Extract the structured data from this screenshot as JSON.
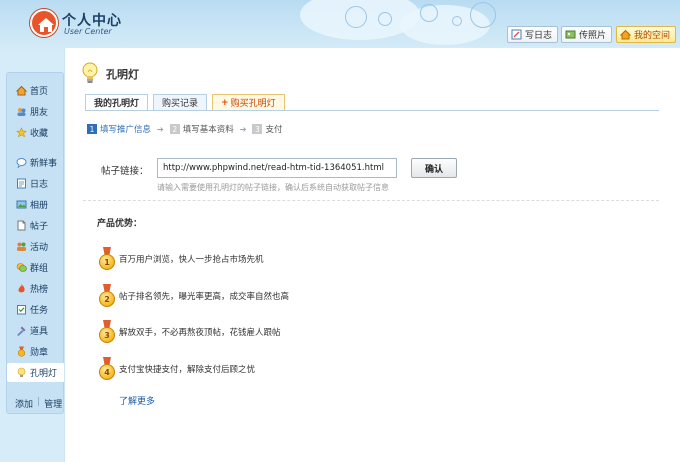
{
  "header": {
    "logo_title": "个人中心",
    "logo_subtitle": "User Center",
    "buttons": [
      {
        "label": "写日志",
        "icon": "edit-icon"
      },
      {
        "label": "传照片",
        "icon": "photo-icon"
      },
      {
        "label": "我的空间",
        "icon": "home-icon"
      }
    ]
  },
  "sidebar": {
    "items": [
      {
        "label": "首页",
        "icon": "home-icon"
      },
      {
        "label": "朋友",
        "icon": "friends-icon"
      },
      {
        "label": "收藏",
        "icon": "star-icon"
      },
      {
        "label": "新鲜事",
        "icon": "speech-bubble-icon"
      },
      {
        "label": "日志",
        "icon": "journal-icon"
      },
      {
        "label": "相册",
        "icon": "album-icon"
      },
      {
        "label": "帖子",
        "icon": "post-icon"
      },
      {
        "label": "活动",
        "icon": "activity-icon"
      },
      {
        "label": "群组",
        "icon": "group-icon"
      },
      {
        "label": "热榜",
        "icon": "hot-list-icon"
      },
      {
        "label": "任务",
        "icon": "task-icon"
      },
      {
        "label": "道具",
        "icon": "tool-icon"
      },
      {
        "label": "勋章",
        "icon": "medal-icon"
      },
      {
        "label": "孔明灯",
        "icon": "lamp-icon",
        "active": true
      }
    ],
    "footer": {
      "add": "添加",
      "separator": "|",
      "manage": "管理"
    }
  },
  "main": {
    "title": "孔明灯",
    "tabs": [
      {
        "label": "我的孔明灯",
        "active": true
      },
      {
        "label": "购买记录"
      },
      {
        "label": "购买孔明灯",
        "prefix": "+"
      }
    ],
    "steps": [
      {
        "num": "1",
        "label": "填写推广信息",
        "active": true
      },
      {
        "num": "2",
        "label": "填写基本资料"
      },
      {
        "num": "3",
        "label": "支付"
      }
    ],
    "step_arrow": "➔",
    "form": {
      "link_label": "帖子链接：",
      "link_value": "http://www.phpwind.net/read-htm-tid-1364051.html",
      "confirm_label": "确认",
      "hint": "请输入需要使用孔明灯的帖子链接，确认后系统自动获取帖子信息"
    },
    "advantages": {
      "title": "产品优势：",
      "items": [
        {
          "num": "1",
          "text": "百万用户浏览，快人一步抢占市场先机"
        },
        {
          "num": "2",
          "text": "帖子排名领先，曝光率更高，成交率自然也高"
        },
        {
          "num": "3",
          "text": "解放双手，不必再熬夜顶帖，花钱雇人跟帖"
        },
        {
          "num": "4",
          "text": "支付宝快捷支付，解除支付后顾之忧"
        }
      ],
      "more_link": "了解更多"
    }
  },
  "colors": {
    "accent": "#2f6fb5",
    "sidebar_bg": "#c6e1f3",
    "header_bg": "#b9dcf2",
    "buy_tab": "#c94600"
  }
}
